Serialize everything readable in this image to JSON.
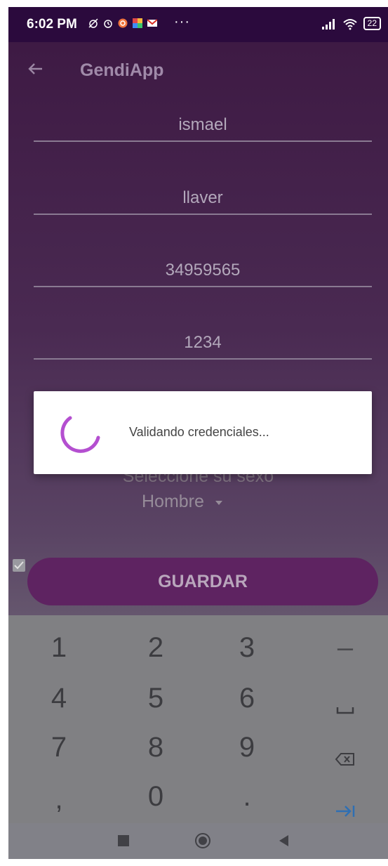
{
  "status_bar": {
    "time": "6:02 PM",
    "more": "···",
    "battery": "22",
    "icons": [
      "alarm-off-icon",
      "alarm-icon",
      "instagram-icon",
      "photos-icon",
      "gmail-icon",
      "signal-icon",
      "wifi-icon",
      "battery-icon"
    ]
  },
  "appbar": {
    "title": "GendiApp",
    "back_icon": "back-arrow-icon"
  },
  "form": {
    "name": "ismael",
    "last_name": "llaver",
    "id_number": "34959565",
    "password": "1234",
    "sex_label": "Seleccione su sexo",
    "sex_value": "Hombre",
    "save_label": "GUARDAR"
  },
  "dialog": {
    "message": "Validando credenciales..."
  },
  "keyboard": {
    "rows": [
      [
        "1",
        "2",
        "3",
        "–"
      ],
      [
        "4",
        "5",
        "6",
        "space"
      ],
      [
        "7",
        "8",
        "9",
        "backspace"
      ],
      [
        ",",
        "0",
        ".",
        "next"
      ]
    ]
  },
  "colors": {
    "status_bar": "#2b0a3d",
    "button": "#5e2361",
    "spinner": "#b44fd0",
    "keyboard": "#808083"
  }
}
